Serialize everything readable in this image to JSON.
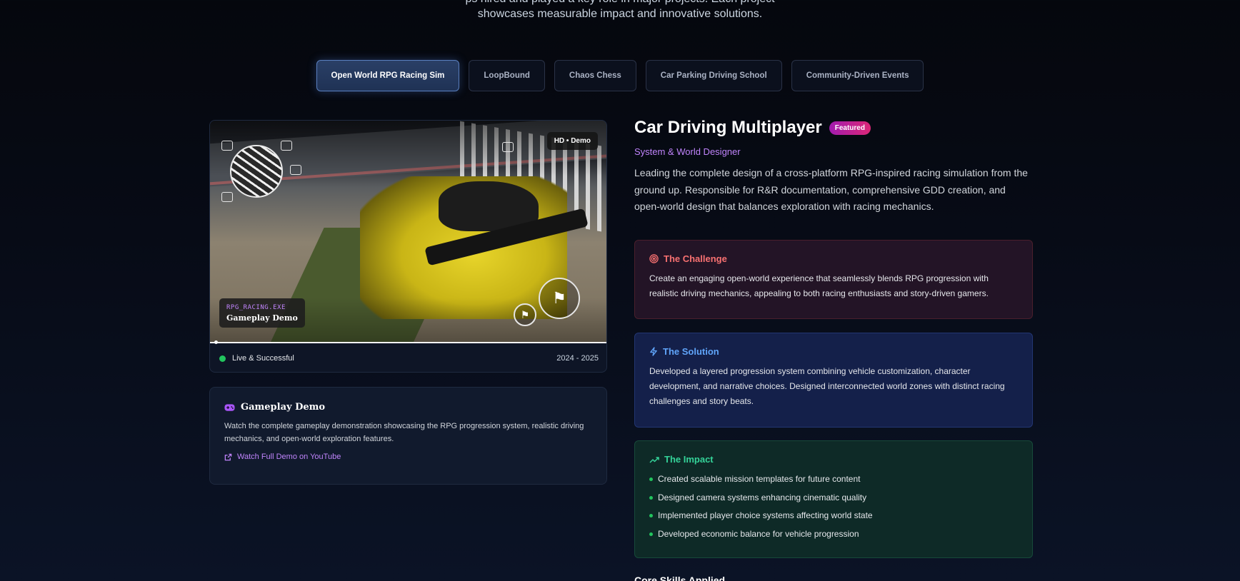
{
  "intro": {
    "line1_cut": "ps hired and played a key role in major projects. Each project",
    "line2": "showcases measurable impact and innovative solutions."
  },
  "tabs": [
    {
      "label": "Open World RPG Racing Sim",
      "active": true
    },
    {
      "label": "LoopBound",
      "active": false
    },
    {
      "label": "Chaos Chess",
      "active": false
    },
    {
      "label": "Car Parking Driving School",
      "active": false
    },
    {
      "label": "Community-Driven Events",
      "active": false
    }
  ],
  "media": {
    "hd_badge": "HD • Demo",
    "exe_label": "RPG_RACING.EXE",
    "demo_label": "Gameplay Demo",
    "progress_fraction": 0.01,
    "status": "Live & Successful",
    "status_color": "#22c55e",
    "years": "2024 - 2025"
  },
  "demo_card": {
    "icon": "gamepad-icon",
    "title": "Gameplay Demo",
    "description": "Watch the complete gameplay demonstration showcasing the RPG progression system, realistic driving mechanics, and open-world exploration features.",
    "link_label": "Watch Full Demo on YouTube"
  },
  "project": {
    "title": "Car Driving Multiplayer",
    "badge": "Featured",
    "role": "System & World Designer",
    "summary": "Leading the complete design of a cross-platform RPG-inspired racing simulation from the ground up. Responsible for R&R documentation, comprehensive GDD creation, and open-world design that balances exploration with racing mechanics.",
    "challenge": {
      "icon": "target-icon",
      "heading": "The Challenge",
      "text": "Create an engaging open-world experience that seamlessly blends RPG progression with realistic driving mechanics, appealing to both racing enthusiasts and story-driven gamers."
    },
    "solution": {
      "icon": "lightning-icon",
      "heading": "The Solution",
      "text": "Developed a layered progression system combining vehicle customization, character development, and narrative choices. Designed interconnected world zones with distinct racing challenges and story beats."
    },
    "impact": {
      "icon": "trending-up-icon",
      "heading": "The Impact",
      "items": [
        "Created scalable mission templates for future content",
        "Designed camera systems enhancing cinematic quality",
        "Implemented player choice systems affecting world state",
        "Developed economic balance for vehicle progression"
      ]
    },
    "core_skills_heading": "Core Skills Applied"
  },
  "colors": {
    "accent_purple": "#c084fc",
    "challenge_red": "#f87171",
    "solution_blue": "#60a5fa",
    "impact_green": "#34d399"
  }
}
